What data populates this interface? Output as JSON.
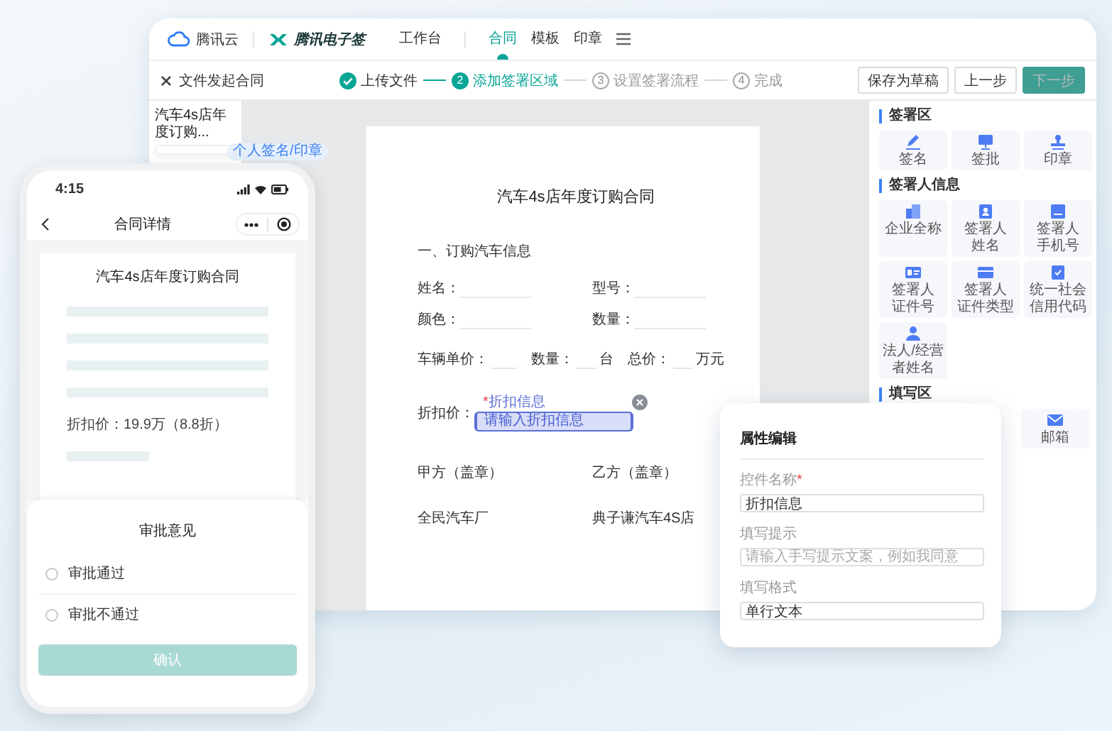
{
  "desktop": {
    "brand": {
      "cloud_name": "腾讯云",
      "product_name": "腾讯电子签"
    },
    "nav": [
      {
        "label": "工作台",
        "selected": false
      },
      {
        "label": "合同",
        "selected": true
      },
      {
        "label": "模板",
        "selected": false
      },
      {
        "label": "印章",
        "selected": false
      }
    ],
    "page_title": "文件发起合同",
    "steps": [
      {
        "label": "上传文件",
        "done": true,
        "selected": false
      },
      {
        "number": "2",
        "label": "添加签署区域",
        "done": false,
        "selected": true
      },
      {
        "number": "3",
        "label": "设置签署流程",
        "done": false,
        "selected": false
      },
      {
        "number": "4",
        "label": "完成",
        "done": false,
        "selected": false
      }
    ],
    "actions": [
      {
        "label": "保存为草稿",
        "kind": "default",
        "disabled": false
      },
      {
        "label": "上一步",
        "kind": "default",
        "disabled": false
      },
      {
        "label": "下一步",
        "kind": "primary",
        "disabled": true
      }
    ],
    "thumbnail": {
      "file_name": "汽车4s店年度订购...",
      "tag": "个人签名/印章"
    },
    "document": {
      "title": "汽车4s店年度订购合同",
      "section": "一、订购汽车信息",
      "fields": [
        {
          "label": "姓名："
        },
        {
          "label": "型号："
        },
        {
          "label": "颜色："
        },
        {
          "label": "数量："
        }
      ],
      "price_line": [
        {
          "label": "车辆单价："
        },
        {
          "label": "数量：",
          "unit": "台"
        },
        {
          "label": "总价：",
          "unit": "万元"
        }
      ],
      "discount_label": "折扣价：",
      "widget": {
        "label": "折扣信息",
        "required_mark": "*",
        "placeholder": "请输入折扣信息"
      },
      "parties": [
        {
          "role": "甲方（盖章）",
          "name": "全民汽车厂"
        },
        {
          "role": "乙方（盖章）",
          "name": "典子谦汽车4S店"
        }
      ]
    },
    "palette": [
      {
        "title": "签署区",
        "items": [
          {
            "lines": [
              "签名"
            ]
          },
          {
            "lines": [
              "签批"
            ]
          },
          {
            "lines": [
              "印章"
            ]
          }
        ]
      },
      {
        "title": "签署人信息",
        "items": [
          {
            "lines": [
              "企业全称"
            ]
          },
          {
            "lines": [
              "签署人",
              "姓名"
            ]
          },
          {
            "lines": [
              "签署人",
              "手机号"
            ]
          },
          {
            "lines": [
              "签署人",
              "证件号"
            ]
          },
          {
            "lines": [
              "签署人",
              "证件类型"
            ]
          },
          {
            "lines": [
              "统一社会",
              "信用代码"
            ]
          },
          {
            "lines": [
              "法人/经营",
              "者姓名"
            ]
          }
        ]
      },
      {
        "title": "填写区",
        "items": [
          {
            "lines": [
              "邮箱"
            ]
          }
        ]
      }
    ]
  },
  "property_panel": {
    "title": "属性编辑",
    "fields": [
      {
        "label": "控件名称",
        "required_mark": "*",
        "value": "折扣信息"
      },
      {
        "label": "填写提示",
        "placeholder": "请输入手写提示文案，例如我同意"
      },
      {
        "label": "填写格式",
        "value": "单行文本"
      }
    ]
  },
  "phone": {
    "time": "4:15",
    "title": "合同详情",
    "document_title": "汽车4s店年度订购合同",
    "discount_line": "折扣价：19.9万（8.8折）",
    "sheet": {
      "title": "审批意见",
      "options": [
        {
          "label": "审批通过",
          "selected": false
        },
        {
          "label": "审批不通过",
          "selected": false
        }
      ],
      "confirm": {
        "label": "确认",
        "disabled": true
      }
    }
  }
}
